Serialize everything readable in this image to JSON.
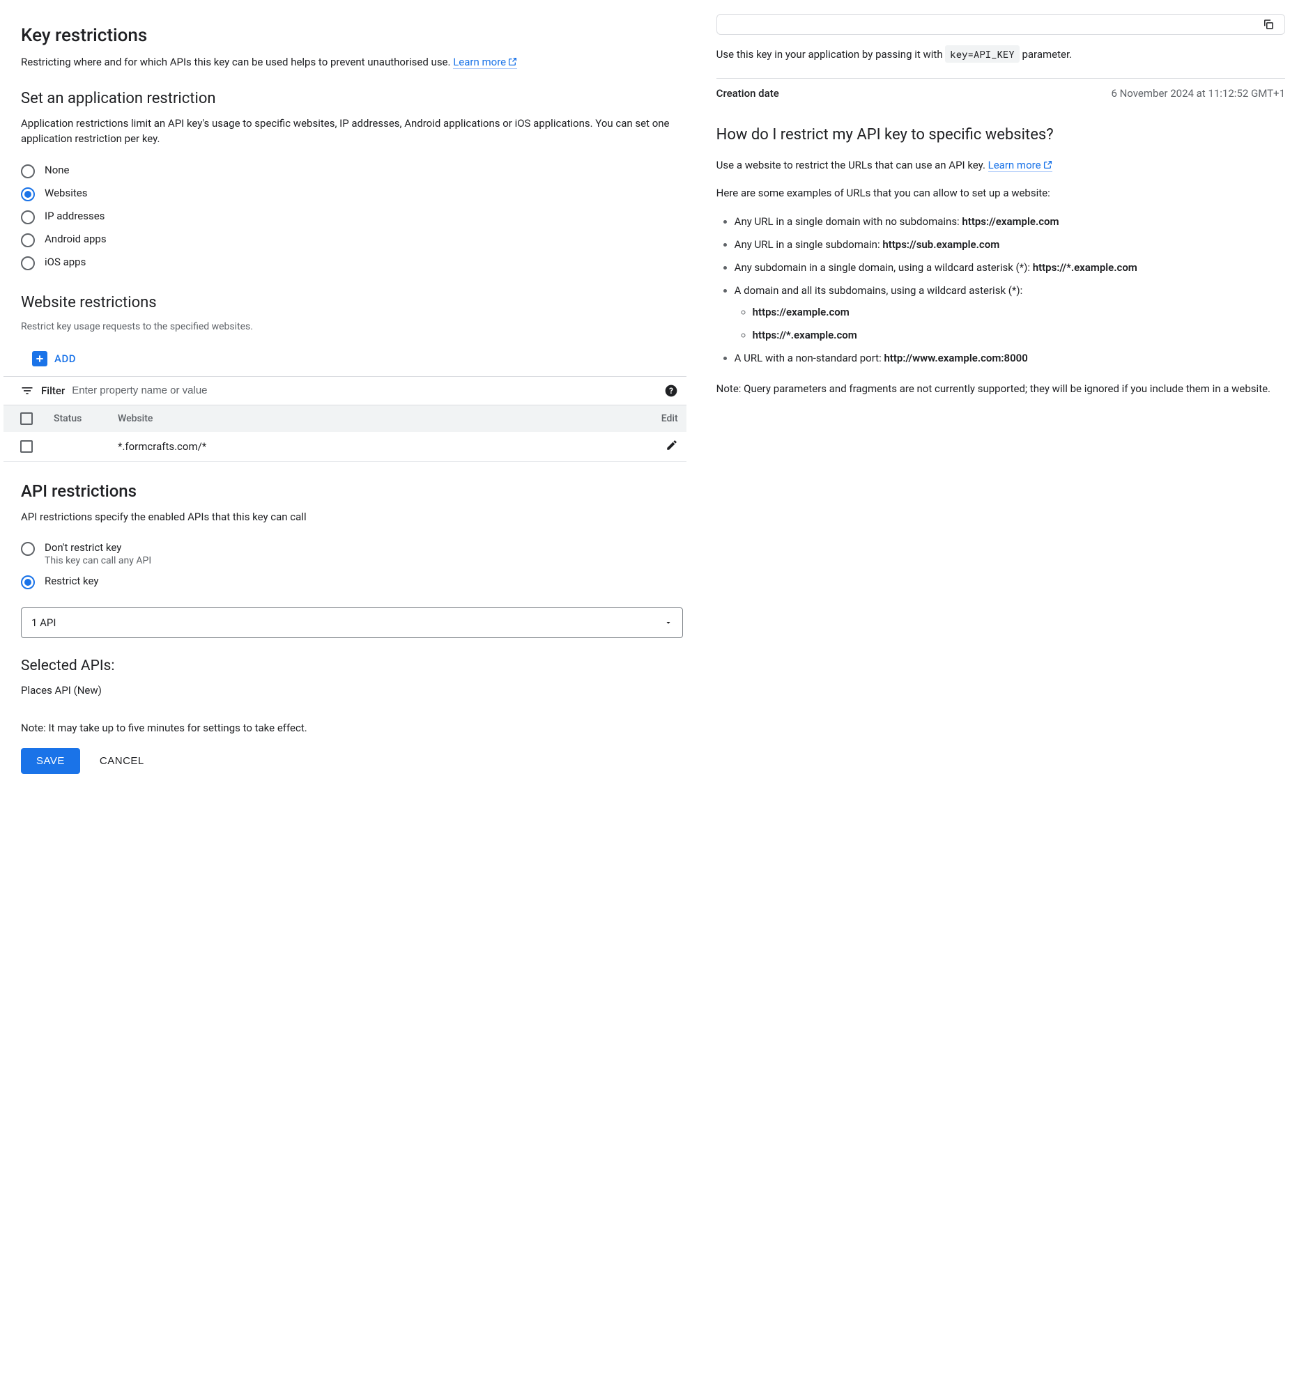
{
  "left": {
    "key_restrictions": {
      "title": "Key restrictions",
      "desc": "Restricting where and for which APIs this key can be used helps to prevent unauthorised use.",
      "learn_more": "Learn more"
    },
    "app_restriction": {
      "title": "Set an application restriction",
      "desc": "Application restrictions limit an API key's usage to specific websites, IP addresses, Android applications or iOS applications. You can set one application restriction per key.",
      "options": [
        {
          "label": "None",
          "selected": false
        },
        {
          "label": "Websites",
          "selected": true
        },
        {
          "label": "IP addresses",
          "selected": false
        },
        {
          "label": "Android apps",
          "selected": false
        },
        {
          "label": "iOS apps",
          "selected": false
        }
      ]
    },
    "website_restrictions": {
      "title": "Website restrictions",
      "desc": "Restrict key usage requests to the specified websites.",
      "add_label": "ADD",
      "filter_label": "Filter",
      "filter_placeholder": "Enter property name or value",
      "columns": {
        "status": "Status",
        "website": "Website",
        "edit": "Edit"
      },
      "rows": [
        {
          "status": "",
          "website": "*.formcrafts.com/*"
        }
      ]
    },
    "api_restrictions": {
      "title": "API restrictions",
      "desc": "API restrictions specify the enabled APIs that this key can call",
      "options": [
        {
          "label": "Don't restrict key",
          "sub": "This key can call any API",
          "selected": false
        },
        {
          "label": "Restrict key",
          "sub": "",
          "selected": true
        }
      ],
      "dropdown_value": "1 API",
      "selected_title": "Selected APIs:",
      "selected_apis": [
        "Places API (New)"
      ],
      "note": "Note: It may take up to five minutes for settings to take effect."
    },
    "actions": {
      "save": "SAVE",
      "cancel": "CANCEL"
    }
  },
  "right": {
    "usage_prefix": "Use this key in your application by passing it with ",
    "usage_code": "key=API_KEY",
    "usage_suffix": " parameter.",
    "creation_label": "Creation date",
    "creation_value": "6 November 2024 at 11:12:52 GMT+1",
    "help": {
      "title": "How do I restrict my API key to specific websites?",
      "intro_prefix": "Use a website to restrict the URLs that can use an API key. ",
      "learn_more": "Learn more",
      "examples_intro": "Here are some examples of URLs that you can allow to set up a website:",
      "examples": [
        {
          "text": "Any URL in a single domain with no subdomains: ",
          "bold": "https://example.com"
        },
        {
          "text": "Any URL in a single subdomain: ",
          "bold": "https://sub.example.com"
        },
        {
          "text": "Any subdomain in a single domain, using a wildcard asterisk (*): ",
          "bold": "https://*.example.com"
        },
        {
          "text": "A domain and all its subdomains, using a wildcard asterisk (*):",
          "sub": [
            "https://example.com",
            "https://*.example.com"
          ]
        },
        {
          "text": "A URL with a non-standard port: ",
          "bold": "http://www.example.com:8000"
        }
      ],
      "note": "Note: Query parameters and fragments are not currently supported; they will be ignored if you include them in a website."
    }
  }
}
